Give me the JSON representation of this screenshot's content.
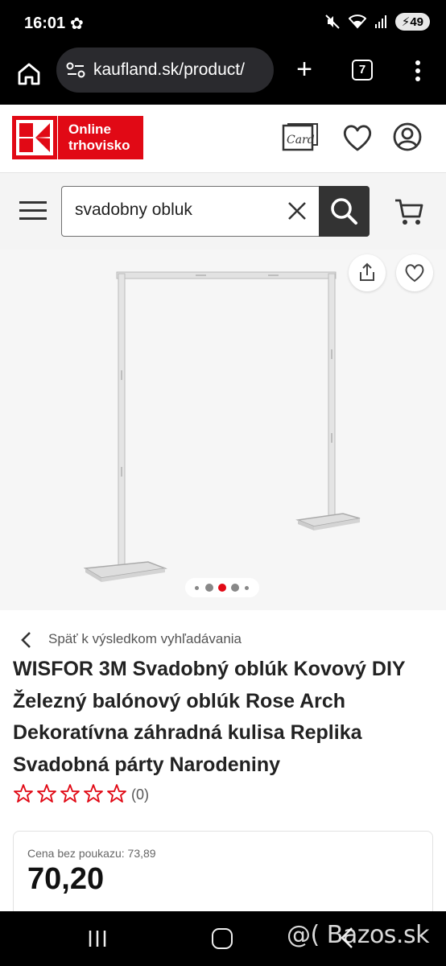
{
  "status": {
    "time": "16:01",
    "battery": "49"
  },
  "browser": {
    "url": "kaufland.sk/product/",
    "tab_count": "7"
  },
  "site": {
    "logo_text": "Online trhovisko"
  },
  "search": {
    "query": "svadobny obluk"
  },
  "gallery": {
    "image_count": 5,
    "active_index": 2
  },
  "product": {
    "back_label": "Späť k výsledkom vyhľadávania",
    "title": "WISFOR 3M Svadobný oblúk Kovový DIY Železný balónový oblúk Rose Arch Dekoratívna záhradná kulisa Replika Svadobná párty Narodeniny",
    "rating": 0,
    "review_count": "(0)",
    "price_old": "Cena bez poukazu: 73,89",
    "price": "70,20"
  },
  "watermark": "@( Bazos.sk",
  "colors": {
    "brand": "#e10915",
    "search_button": "#333333",
    "active_dot": "#e10915"
  }
}
